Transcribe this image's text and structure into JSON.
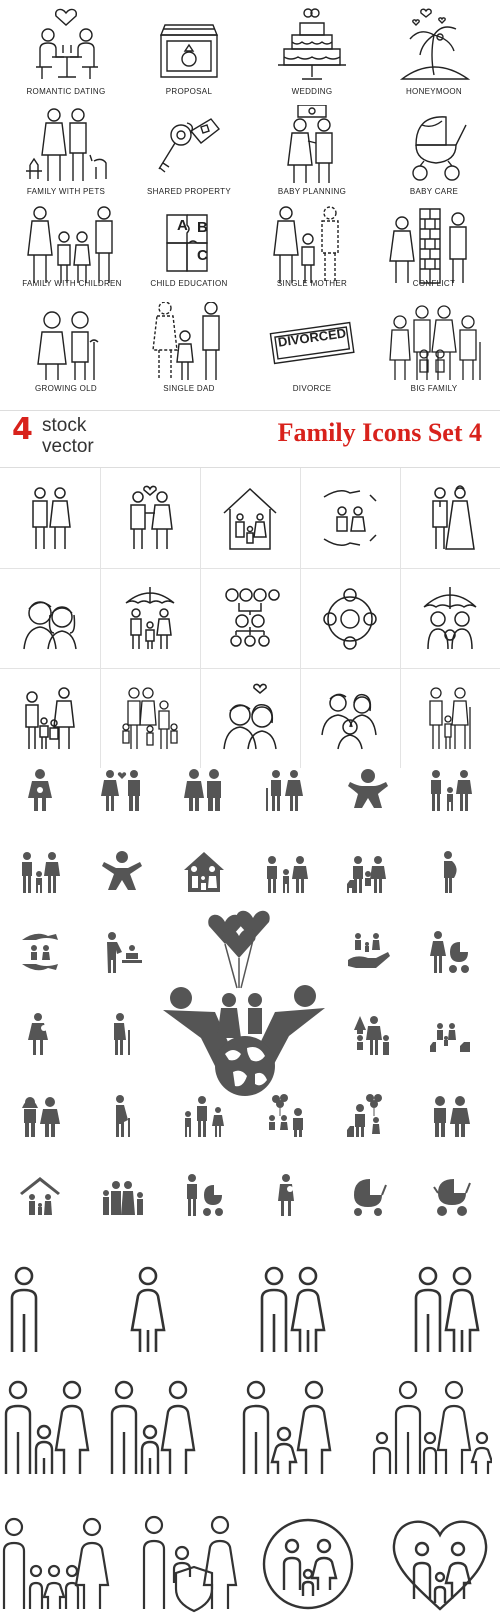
{
  "outline_set": {
    "labels": [
      "ROMANTIC DATING",
      "PROPOSAL",
      "WEDDING",
      "HONEYMOON",
      "FAMILY WITH PETS",
      "SHARED PROPERTY",
      "BABY PLANNING",
      "BABY CARE",
      "FAMILY WITH CHILDREN",
      "CHILD EDUCATION",
      "SINGLE MOTHER",
      "CONFLICT",
      "GROWING OLD",
      "SINGLE DAD",
      "DIVORCE",
      "BIG FAMILY"
    ],
    "stamp_text": "DIVORCED",
    "puzzle_letters": [
      "A",
      "B",
      "C"
    ]
  },
  "banner": {
    "brand_number": "4",
    "brand_word1": "stock",
    "brand_word2": "vector",
    "title": "Family Icons Set 4"
  },
  "colors": {
    "brand_red": "#d8221c",
    "icon_gray": "#555555",
    "line": "#222222"
  }
}
